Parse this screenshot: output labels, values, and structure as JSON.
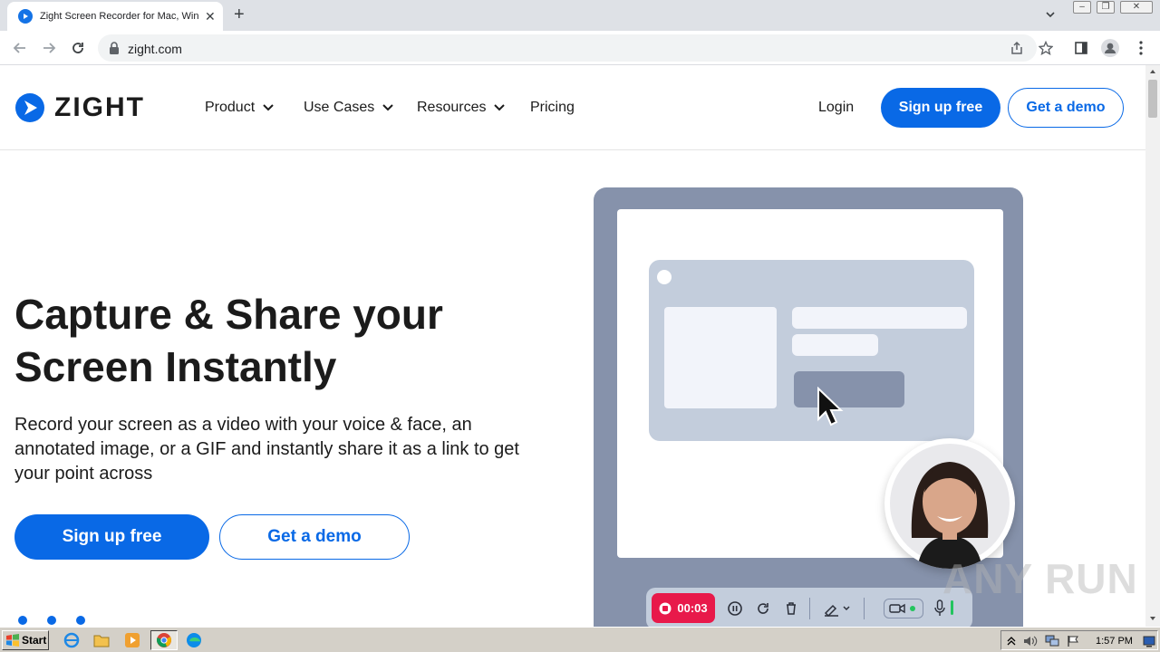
{
  "browser": {
    "tab_title": "Zight Screen Recorder for Mac, Windows",
    "tab_close": "✕",
    "new_tab": "+",
    "url": "zight.com"
  },
  "nav": {
    "logo_text": "ZIGHT",
    "menu": [
      "Product",
      "Use Cases",
      "Resources",
      "Pricing"
    ],
    "login": "Login",
    "signup": "Sign up free",
    "demo": "Get a demo"
  },
  "hero": {
    "title": "Capture & Share your Screen Instantly",
    "subtitle": "Record your screen as a video with your voice & face, an annotated image, or a GIF and instantly share it as a link to get your point across",
    "signup": "Sign up free",
    "demo": "Get a demo"
  },
  "illustration": {
    "timer": "00:03"
  },
  "watermark": "ANY RUN",
  "taskbar": {
    "start": "Start",
    "clock": "1:57 PM"
  },
  "colors": {
    "brand_blue": "#0969e6",
    "record_red": "#e8194a",
    "frame_slate": "#8692ab"
  }
}
